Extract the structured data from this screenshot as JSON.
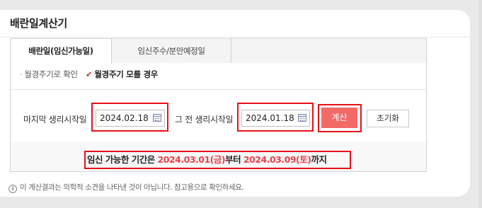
{
  "title": "배란일계산기",
  "tabs": [
    {
      "label": "배란일(임신가능일)",
      "active": true
    },
    {
      "label": "임신주수/분만예정일",
      "active": false
    }
  ],
  "options": {
    "opt1": "월경주기로 확인",
    "opt2": "월경주기 모를 경우",
    "selected": "opt2"
  },
  "form": {
    "last_period_label": "마지막 생리시작일",
    "last_period_value": "2024.02.18",
    "prev_period_label": "그 전 생리시작일",
    "prev_period_value": "2024.01.18",
    "calc_button": "계산",
    "reset_button": "초기화"
  },
  "result": {
    "prefix": "임신 가능한 기간은 ",
    "start": "2024.03.01(금)",
    "middle": "부터 ",
    "end": "2024.03.09(토)",
    "suffix": "까지"
  },
  "note": "이 계산결과는 의학적 소견을 나타낸 것이 아닙니다. 참고용으로 확인하세요.",
  "colors": {
    "accent_red": "#e8101a",
    "result_red": "#e8424a",
    "calc_button_bg": "#f26a66"
  },
  "icons": {
    "calendar": "calendar-icon",
    "check": "check-icon",
    "info": "info-icon"
  }
}
